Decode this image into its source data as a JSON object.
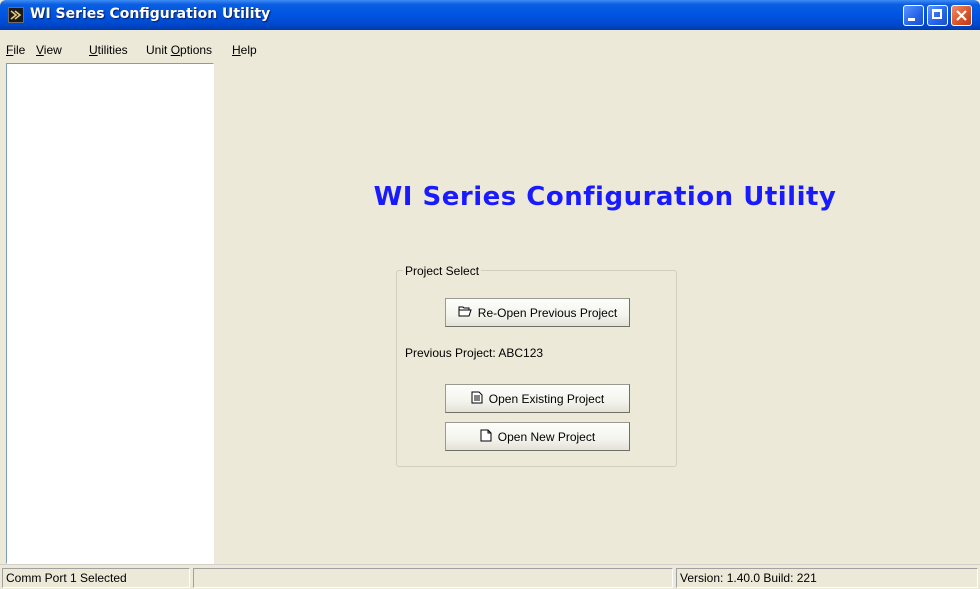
{
  "window": {
    "title": "WI Series Configuration Utility"
  },
  "menu": {
    "items": [
      {
        "label_pre": "",
        "label_u": "F",
        "label_post": "ile"
      },
      {
        "label_pre": "",
        "label_u": "V",
        "label_post": "iew"
      },
      {
        "label_pre": "",
        "label_u": "U",
        "label_post": "tilities"
      },
      {
        "label_pre": "Unit ",
        "label_u": "O",
        "label_post": "ptions"
      },
      {
        "label_pre": "",
        "label_u": "H",
        "label_post": "elp"
      }
    ]
  },
  "main": {
    "title": "WI Series Configuration Utility",
    "project_select": {
      "legend": "Project Select",
      "reopen_label": "Re-Open Previous Project",
      "previous_project_label": "Previous Project:  ABC123",
      "open_existing_label": "Open Existing Project",
      "open_new_label": "Open New Project"
    }
  },
  "status": {
    "comm_port": "Comm Port 1 Selected",
    "middle": "",
    "version": "Version: 1.40.0 Build: 221"
  },
  "colors": {
    "title_text": "#1a1aff",
    "titlebar": "#0054e3",
    "background": "#ece9d8"
  },
  "icons": {
    "app": "app-icon",
    "reopen": "open-folder-icon",
    "existing": "document-icon",
    "new": "new-document-icon"
  }
}
